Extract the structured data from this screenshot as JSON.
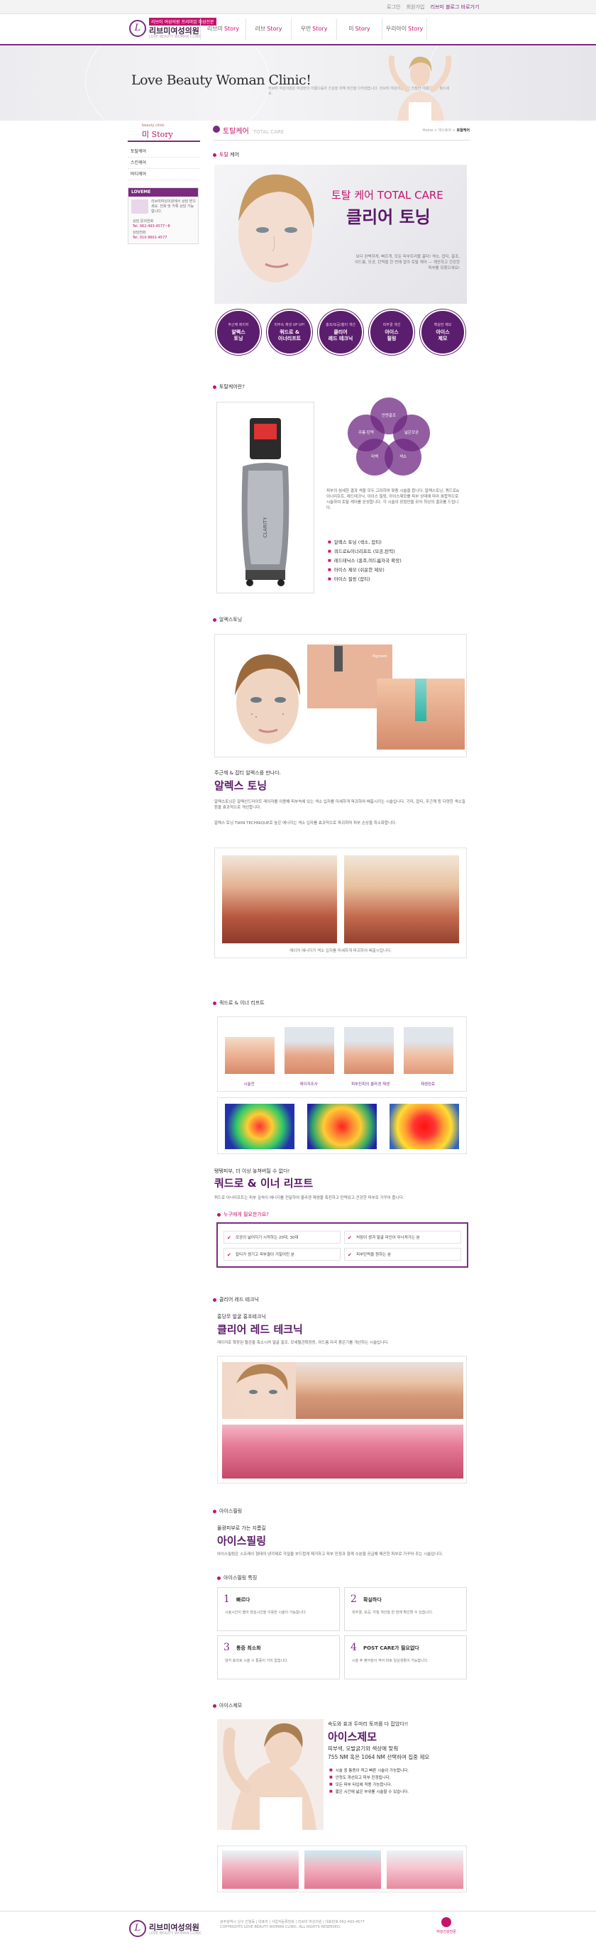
{
  "topbar": {
    "links": [
      "로그인",
      "회원가입",
      "리브미 블로그 바로가기"
    ]
  },
  "brand": {
    "tag": "리브미 여성의원 프리미엄 여성전문",
    "name": "리브미여성의원",
    "sub": "LOVE BEAUTY WOMAN CLINIC"
  },
  "gnb": [
    {
      "pre": "리브미",
      "em": "Story"
    },
    {
      "pre": "러브",
      "em": "Story"
    },
    {
      "pre": "우먼",
      "em": "Story"
    },
    {
      "pre": "미",
      "em": "Story"
    },
    {
      "pre": "우리아이",
      "em": "Story"
    }
  ],
  "visual": {
    "title": "Love Beauty Woman Clinic!",
    "desc": "리브미 여성의원은 여성만의 아름다움과 건강을 위해 최선을 다하겠습니다. 리브미 여성의원에서 진정한 아름다움을 찾으세요."
  },
  "lnb": {
    "small": "beauty clinic",
    "title_pre": "미",
    "title_em": "Story",
    "items": [
      "토탈케어",
      "스킨케어",
      "바디케어"
    ]
  },
  "banner": {
    "head": "LOVEME",
    "text": "리브미여성의원에서 상담 받으세요. 전화 및 카톡 상담 가능합니다.",
    "l1": "상담 문의전화",
    "l2": "Tel. 062-493-4577~8",
    "l3": "상담전화",
    "l4": "Tel. 010-9601-4577"
  },
  "pagehead": {
    "title": "토탈케어",
    "eng": "TOTAL CARE",
    "loc": "Home > 미스토리 > ",
    "loc_cur": "토탈케어"
  },
  "s1": {
    "title_pre": "토탈",
    "title_em": "케어",
    "hero_t1": "토탈 케어 TOTAL CARE",
    "hero_t2": "클리어 토닝",
    "hero_desc": "보다 완벽하게, 빠르게, 모든 피부트러블 흉터! 색소, 잡티, 홍조, 여드름, 모공, 탄력을 한 번에 잡아 토탈 케어 — 깨끗하고 건강한 피부를 되찾으세요!"
  },
  "circles": [
    {
      "small": "주근깨 레이저",
      "b1": "알렉스",
      "b2": "토닝"
    },
    {
      "small": "피부속 재생 UP UP!",
      "b1": "쿼드로 &",
      "b2": "이너리프트"
    },
    {
      "small": "홍조/모공/흉터 개선",
      "b1": "클리어",
      "b2": "레드 테크닉"
    },
    {
      "small": "피부결 개선",
      "b1": "아이스",
      "b2": "필링"
    },
    {
      "small": "확실한 제모",
      "b1": "아이스",
      "b2": "제모"
    }
  ],
  "s2": {
    "title": "토탈케어란?",
    "venn": [
      "안면홍조",
      "주름·탄력",
      "넓은모공",
      "미백",
      "색소"
    ],
    "desc": "피부의 섬세한 결과 색을 모두 고려하여 맞춤 시술을 합니다. 알렉스토닝, 쿼드로&이너리프트, 레드테크닉, 아이스 필링, 아이스제모를 피부 상태에 따라 복합적으로 시술하여 토탈 케어를 완성합니다. 각 시술의 장점만을 모아 최상의 결과를 드립니다.",
    "list": [
      "알렉스 토닝 (색소, 잡티)",
      "쿼드로&이너리프트 (모공,탄력)",
      "레드테닉스 (홍조,여드름자국 확장)",
      "아이스 제모 (쉬운한 제모)",
      "아이스 필링 (잡티)"
    ],
    "device": "CLARITY"
  },
  "s3": {
    "title": "알렉스토닝",
    "kicker": "주근깨 & 잡티 알렉스를 만나다.",
    "h2": "알렉스 토닝",
    "desc1": "알렉스토닝은 알렉산드라이트 레이저를 이용해 피부속에 있는 색소 입자를 미세하게 파괴하여 배출시키는 시술입니다. 기미, 잡티, 주근깨 등 다양한 색소질환을 효과적으로 개선합니다.",
    "desc2": "알렉스 토닝 TWIN TECHNIQUE로 높은 에너지는 색소 입자를 효과적으로 파괴하며 피부 손상을 최소화합니다.",
    "pigment": "Pigment",
    "caption": "레이저 에너지가 색소 입자를 미세하게 파괴하여 배출시킵니다."
  },
  "s4": {
    "title": "쿼드로 & 이너 리프트",
    "labels": [
      "시술전",
      "레이저조사",
      "피부진피의 콜라겐 재생",
      "재생완료"
    ],
    "kicker": "탱탱피부, 더 이상 놓쳐버릴 수 없다!",
    "h2": "쿼드로 & 이너 리프트",
    "desc": "쿼드로 이너리프트는 피부 깊숙이 에너지를 전달하여 콜라겐 재생을 촉진하고 탄력있고 건강한 피부로 가꾸어 줍니다.",
    "who_title": "누구에게 필요한가요?",
    "who": [
      "모공이 넓어지기 시작하는 20대, 30대",
      "잡티가 생기고 피부결이 거칠어진 분",
      "처짐이 생겨 얼굴 라인이 무너져가는 분",
      "피부탄력을 원하는 분"
    ]
  },
  "s5": {
    "title": "클리어 레드 테크닉",
    "kicker": "홍당무 얼굴 홍조테크닉",
    "h2": "클리어 레드 테크닉",
    "desc": "레이저로 확장된 혈관을 축소시켜 얼굴 홍조, 모세혈관확장증, 여드름 자국 붉은기를 개선하는 시술입니다."
  },
  "s6": {
    "title": "아이스필링",
    "kicker": "물광피부로 가는 지름길",
    "h2": "아이스필링",
    "desc": "아이스필링은 스프레이 형태의 냉각제로 각질을 부드럽게 제거하고 피부 진정과 함께 수분을 공급해 매끈한 피부로 가꾸어 주는 시술입니다.",
    "feat_title": "아이스필링 특징",
    "feats": [
      {
        "n": "1",
        "t": "빠르다",
        "d": "시술시간이 짧아 점심시간을 이용한 시술이 가능합니다."
      },
      {
        "n": "2",
        "t": "확실하다",
        "d": "피부결, 모공, 각질 개선을 한 번에 확인할 수 있습니다."
      },
      {
        "n": "3",
        "t": "통증 최소화",
        "d": "냉각 효과로 시술 시 통증이 거의 없습니다."
      },
      {
        "n": "4",
        "t": "POST CARE가 필요없다",
        "d": "시술 후 붉어짐이 적어 바로 일상생활이 가능합니다."
      }
    ]
  },
  "s7": {
    "title": "아이스제모",
    "kicker": "속도와 효과 두마리 토끼를 다 잡았다!!",
    "h2": "아이스제모",
    "sub1": "피부색, 모발굵기와 색상에 맞춰",
    "sub2": "755 NM 혹은 1064 NM 선택하여 집중 제모",
    "list": [
      "시술 중 통증이 적고 빠른 시술이 가능합니다.",
      "안정도 개선되고 피부 진정됩니다.",
      "모든 피부 타입에 적용 가능합니다.",
      "짧은 시간에 넓은 부위를 시술할 수 있습니다."
    ]
  },
  "footer": {
    "addr": "광주광역시 남구 진월동 | 대표자 | 사업자등록번호 | 리브미 여성의원 | 대표번호 062-493-4577",
    "copy": "COPYRIGHTS LOVE BEAUTY WOMAN CLINIC. ALL RIGHTS RESERVED.",
    "badge": "여성건강전문"
  }
}
